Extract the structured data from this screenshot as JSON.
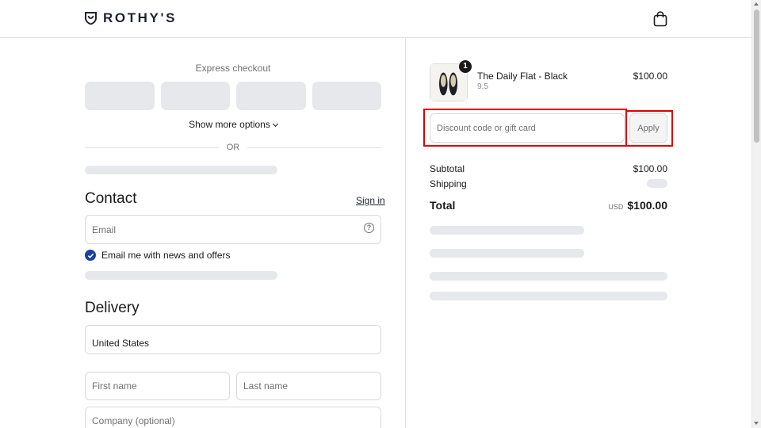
{
  "header": {
    "brand": "ROTHY'S"
  },
  "express": {
    "label": "Express checkout",
    "show_more": "Show more options",
    "or": "OR"
  },
  "contact": {
    "title": "Contact",
    "sign_in": "Sign in",
    "email_placeholder": "Email",
    "email_help": "?",
    "newsletter_label": "Email me with news and offers",
    "newsletter_checked": true
  },
  "delivery": {
    "title": "Delivery",
    "country": "United States",
    "first_name_placeholder": "First name",
    "last_name_placeholder": "Last name",
    "company_placeholder": "Company (optional)"
  },
  "cart": {
    "product_name": "The Daily Flat - Black",
    "product_variant": "9.5",
    "product_price": "$100.00",
    "quantity": "1"
  },
  "discount": {
    "placeholder": "Discount code or gift card",
    "apply_label": "Apply"
  },
  "summary": {
    "subtotal_label": "Subtotal",
    "subtotal_value": "$100.00",
    "shipping_label": "Shipping",
    "total_label": "Total",
    "currency": "USD",
    "total_value": "$100.00"
  },
  "colors": {
    "accent": "#1b3fa6",
    "highlight": "#e00000",
    "skeleton": "#e7e8ec"
  }
}
